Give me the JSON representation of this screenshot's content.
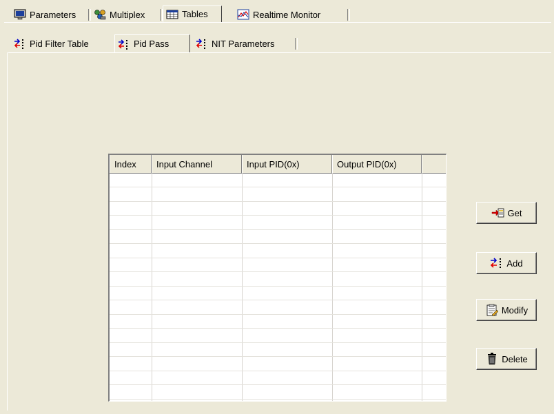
{
  "tabs_main": [
    {
      "label": "Parameters",
      "icon": "monitor-icon"
    },
    {
      "label": "Multiplex",
      "icon": "multiplex-icon"
    },
    {
      "label": "Tables",
      "icon": "table-icon"
    },
    {
      "label": "Realtime Monitor",
      "icon": "chart-icon"
    }
  ],
  "tabs_main_selected": "Tables",
  "tabs_sub": [
    {
      "label": "Pid Filter Table",
      "icon": "pid-arrows-icon"
    },
    {
      "label": "Pid Pass",
      "icon": "pid-arrows-icon"
    },
    {
      "label": "NIT Parameters",
      "icon": "pid-arrows-icon"
    }
  ],
  "tabs_sub_selected": "Pid Pass",
  "table": {
    "columns": [
      "Index",
      "Input Channel",
      "Input PID(0x)",
      "Output PID(0x)",
      ""
    ],
    "rows": []
  },
  "buttons": {
    "get": "Get",
    "add": "Add",
    "modify": "Modify",
    "delete": "Delete"
  },
  "colors": {
    "window_bg": "#ece9d8",
    "grid_bg": "#ffffff",
    "icon_red": "#e00000",
    "icon_blue": "#0000c8"
  }
}
